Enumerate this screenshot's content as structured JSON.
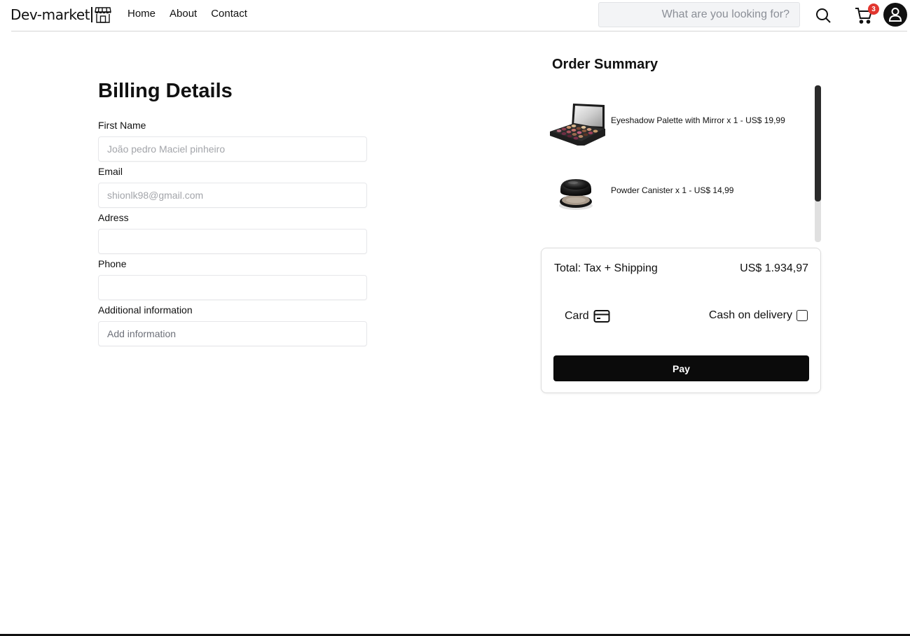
{
  "navbar": {
    "brand": "Dev-market",
    "brand_icon": "store-icon",
    "links": [
      "Home",
      "About",
      "Contact"
    ],
    "search_placeholder": "What are you looking for?",
    "cart_count": "3",
    "icons": {
      "search": "search-icon",
      "cart": "cart-icon",
      "account": "user-icon"
    }
  },
  "billing": {
    "title": "Billing Details",
    "fields": [
      {
        "label": "First Name",
        "placeholder": "João pedro Maciel pinheiro"
      },
      {
        "label": "Email",
        "placeholder": "shionlk98@gmail.com"
      },
      {
        "label": "Adress",
        "placeholder": ""
      },
      {
        "label": "Phone",
        "placeholder": ""
      },
      {
        "label": "Additional information",
        "placeholder": "Add information"
      }
    ]
  },
  "order": {
    "title": "Order Summary",
    "items": [
      {
        "text": "Eyeshadow Palette with Mirror x 1 - US$ 19,99",
        "image": "eyeshadow-palette-image"
      },
      {
        "text": "Powder Canister x 1 - US$ 14,99",
        "image": "powder-canister-image"
      }
    ],
    "total_label": "Total: Tax + Shipping",
    "total_value": "US$ 1.934,97",
    "payment_card": "Card",
    "payment_card_icon": "credit-card-icon",
    "payment_cash": "Cash on delivery",
    "pay_button": "Pay"
  },
  "colors": {
    "badge": "#e2362f",
    "button": "#0b0b0b",
    "input_bg": "#f3f4f6"
  }
}
